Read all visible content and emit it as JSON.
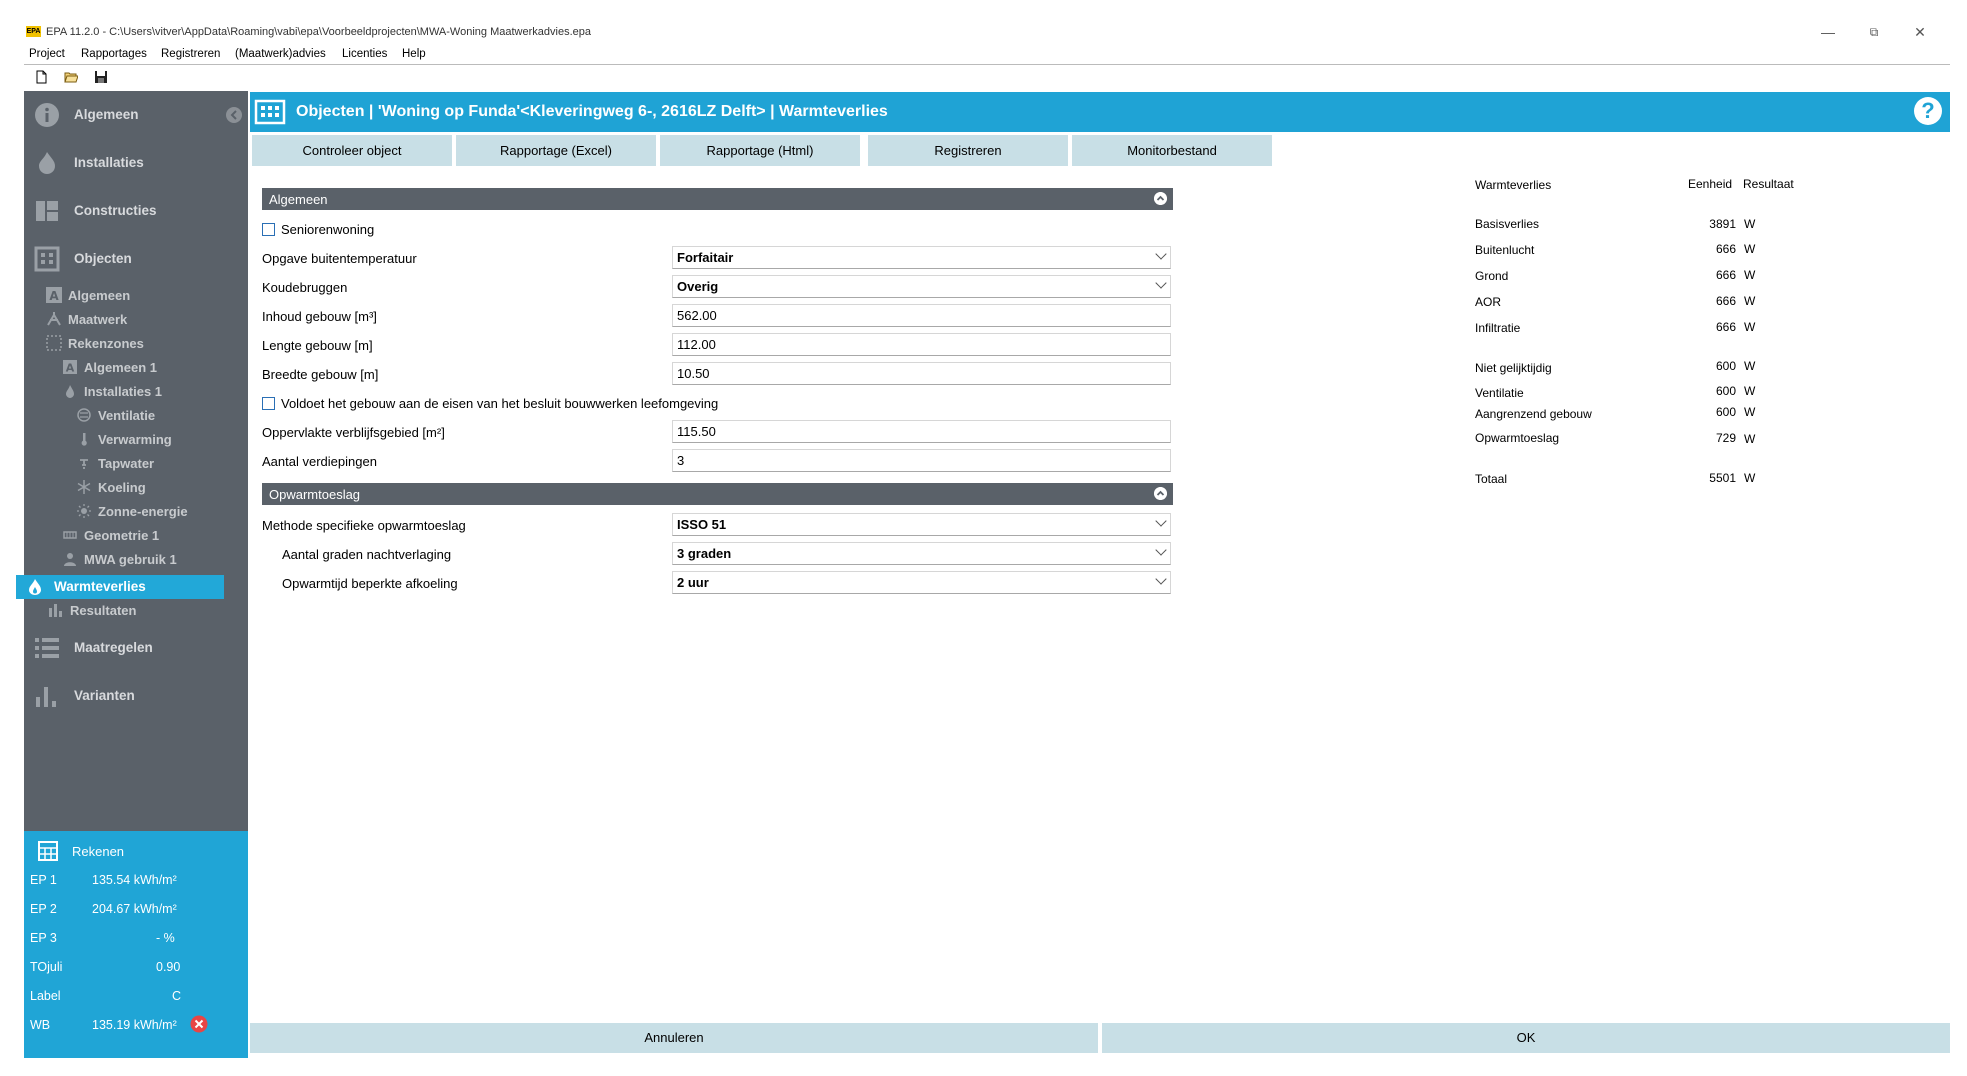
{
  "window": {
    "title": "EPA 11.2.0 - C:\\Users\\vitver\\AppData\\Roaming\\vabi\\epa\\Voorbeeldprojecten\\MWA-Woning Maatwerkadvies.epa",
    "logo": "EPA",
    "minimize": "—",
    "restore": "⧉",
    "close": "✕"
  },
  "menu": [
    "Project",
    "Rapportages",
    "Registreren",
    "(Maatwerk)advies",
    "Licenties",
    "Help"
  ],
  "toolbar_icons": [
    "new-file-icon",
    "open-folder-icon",
    "save-icon"
  ],
  "sidebar": {
    "main_items": [
      {
        "label": "Algemeen",
        "icon": "info-icon"
      },
      {
        "label": "Installaties",
        "icon": "flame-icon"
      },
      {
        "label": "Constructies",
        "icon": "construction-icon"
      },
      {
        "label": "Objecten",
        "icon": "building-icon"
      },
      {
        "label": "Maatregelen",
        "icon": "list-icon"
      },
      {
        "label": "Varianten",
        "icon": "bar-chart-icon"
      }
    ],
    "sub_items": [
      {
        "label": "Algemeen",
        "icon": "letter-a-icon"
      },
      {
        "label": "Maatwerk",
        "icon": "tool-icon"
      },
      {
        "label": "Rekenzones",
        "icon": "zones-icon"
      },
      {
        "label": "Algemeen 1",
        "icon": "letter-a-icon"
      },
      {
        "label": "Installaties 1",
        "icon": "flame-icon"
      },
      {
        "label": "Ventilatie",
        "icon": "fan-icon"
      },
      {
        "label": "Verwarming",
        "icon": "thermometer-icon"
      },
      {
        "label": "Tapwater",
        "icon": "tap-icon"
      },
      {
        "label": "Koeling",
        "icon": "snowflake-icon"
      },
      {
        "label": "Zonne-energie",
        "icon": "sun-icon"
      },
      {
        "label": "Geometrie 1",
        "icon": "geometry-icon"
      },
      {
        "label": "MWA gebruik 1",
        "icon": "user-icon"
      },
      {
        "label": "Warmteverlies",
        "icon": "flame-icon"
      },
      {
        "label": "Resultaten",
        "icon": "bar-chart-icon"
      }
    ],
    "collapse_icon": "chevron-left-icon"
  },
  "rekenen": {
    "title": "Rekenen",
    "rows": [
      {
        "label": "EP 1",
        "value": "135.54 kWh/m²"
      },
      {
        "label": "EP 2",
        "value": "204.67 kWh/m²"
      },
      {
        "label": "EP 3",
        "value": "-  %"
      },
      {
        "label": "TOjuli",
        "value": "0.90"
      },
      {
        "label": "Label",
        "value": "C"
      },
      {
        "label": "WB",
        "value": "135.19 kWh/m²"
      }
    ],
    "error_icon": "error-icon"
  },
  "header": {
    "title": "Objecten | 'Woning op Funda'<Kleveringweg 6-, 2616LZ Delft> | Warmteverlies",
    "help": "?"
  },
  "actions": [
    "Controleer object",
    "Rapportage (Excel)",
    "Rapportage (Html)",
    "Registreren",
    "Monitorbestand"
  ],
  "sections": {
    "algemeen": {
      "title": "Algemeen",
      "checkbox_senior": "Seniorenwoning",
      "fields": [
        {
          "label": "Opgave buitentemperatuur",
          "value": "Forfaitair"
        },
        {
          "label": "Koudebruggen",
          "value": "Overig"
        },
        {
          "label": "Inhoud gebouw [m³]",
          "value": "562.00"
        },
        {
          "label": "Lengte gebouw [m]",
          "value": "112.00"
        },
        {
          "label": "Breedte gebouw [m]",
          "value": "10.50"
        }
      ],
      "checkbox_leefomgeving": "Voldoet het gebouw aan de eisen van het besluit bouwwerken leefomgeving",
      "fields2": [
        {
          "label": "Oppervlakte verblijfsgebied [m²]",
          "value": "115.50"
        },
        {
          "label": "Aantal verdiepingen",
          "value": "3"
        }
      ]
    },
    "opwarmtoeslag": {
      "title": "Opwarmtoeslag",
      "fields": [
        {
          "label": "Methode specifieke opwarmtoeslag",
          "value": "ISSO 51"
        },
        {
          "label": "Aantal graden nachtverlaging",
          "value": "3 graden"
        },
        {
          "label": "Opwarmtijd beperkte afkoeling",
          "value": "2 uur"
        }
      ]
    }
  },
  "results": {
    "header": {
      "name": "Warmteverlies",
      "unit": "Eenheid",
      "result": "Resultaat"
    },
    "rows": [
      {
        "name": "Basisverlies",
        "value": "3891",
        "unit": "W"
      },
      {
        "name": "Buitenlucht",
        "value": "666",
        "unit": "W"
      },
      {
        "name": "Grond",
        "value": "666",
        "unit": "W"
      },
      {
        "name": "AOR",
        "value": "666",
        "unit": "W"
      },
      {
        "name": "Infiltratie",
        "value": "666",
        "unit": "W"
      },
      {
        "name": "Niet gelijktijdig",
        "value": "600",
        "unit": "W"
      },
      {
        "name": "Ventilatie",
        "value": "600",
        "unit": "W"
      },
      {
        "name": "Aangrenzend gebouw",
        "value": "600",
        "unit": "W"
      },
      {
        "name": "Opwarmtoeslag",
        "value": "729",
        "unit": "W"
      },
      {
        "name": "Totaal",
        "value": "5501",
        "unit": "W"
      }
    ]
  },
  "footer": {
    "cancel": "Annuleren",
    "ok": "OK"
  }
}
